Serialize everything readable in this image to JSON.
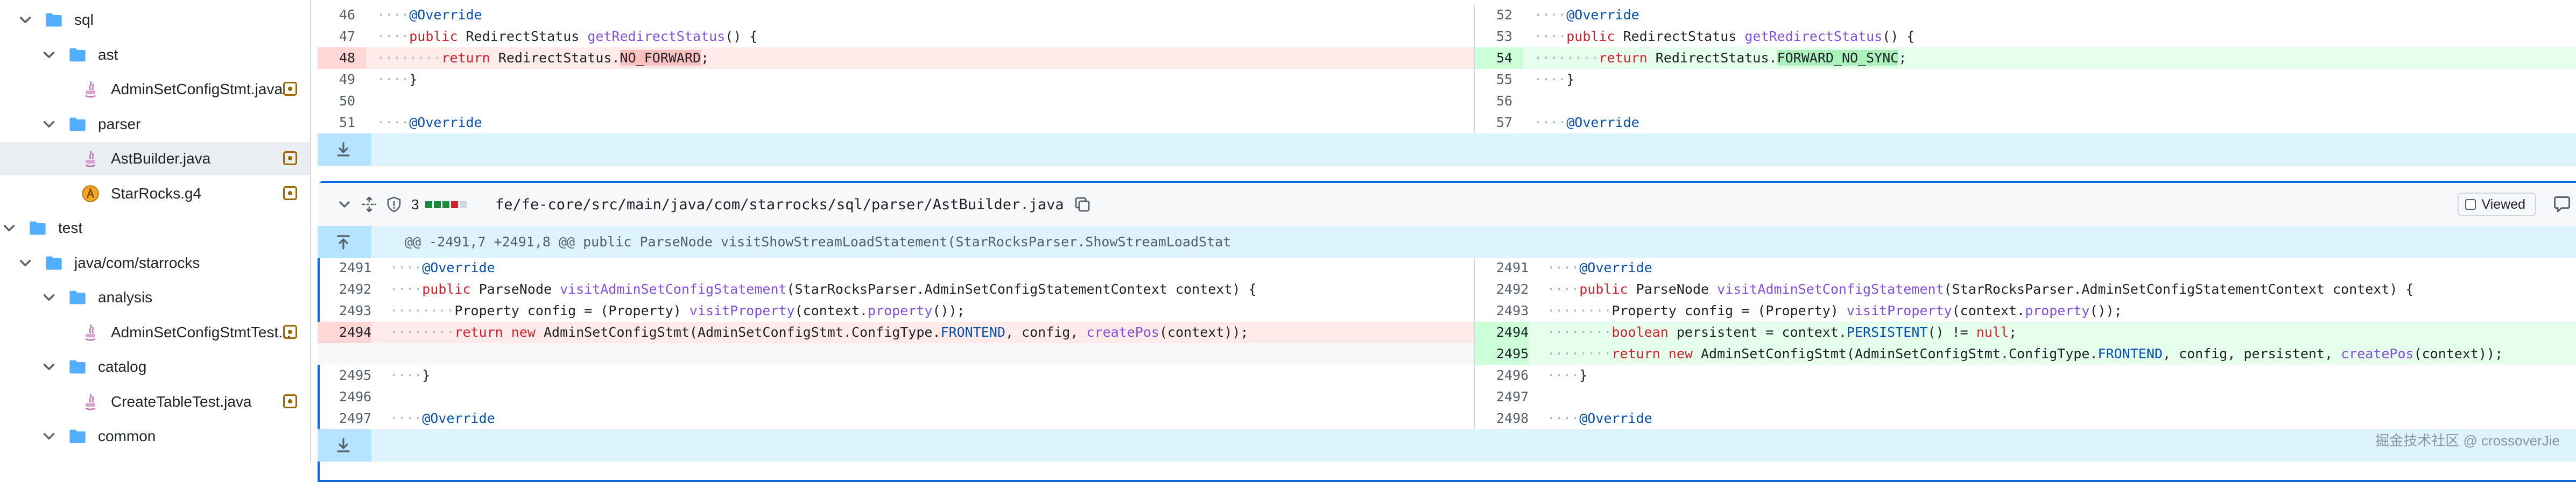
{
  "file_tree": [
    {
      "type": "folder",
      "label": "sql",
      "depth": 0,
      "expanded": true
    },
    {
      "type": "folder",
      "label": "ast",
      "depth": 1,
      "expanded": true
    },
    {
      "type": "file",
      "icon": "java",
      "label": "AdminSetConfigStmt.java",
      "depth": 2,
      "modified": true
    },
    {
      "type": "folder",
      "label": "parser",
      "depth": 1,
      "expanded": true
    },
    {
      "type": "file",
      "icon": "java",
      "label": "AstBuilder.java",
      "depth": 2,
      "modified": true,
      "selected": true
    },
    {
      "type": "file",
      "icon": "antlr",
      "label": "StarRocks.g4",
      "depth": 2,
      "modified": true
    },
    {
      "type": "folder",
      "label": "test",
      "depth": -1,
      "expanded": true
    },
    {
      "type": "folder",
      "label": "java/com/starrocks",
      "depth": 0,
      "expanded": true
    },
    {
      "type": "folder",
      "label": "analysis",
      "depth": 1,
      "expanded": true
    },
    {
      "type": "file",
      "icon": "java",
      "label": "AdminSetConfigStmtTest...",
      "depth": 2,
      "modified": true
    },
    {
      "type": "folder",
      "label": "catalog",
      "depth": 1,
      "expanded": true
    },
    {
      "type": "file",
      "icon": "java",
      "label": "CreateTableTest.java",
      "depth": 2,
      "modified": true
    },
    {
      "type": "folder",
      "label": "common",
      "depth": 1,
      "expanded": true
    }
  ],
  "top_diff": {
    "left": [
      {
        "n": "46",
        "code": "····@Override",
        "kind": "ctx"
      },
      {
        "n": "47",
        "code": "····public RedirectStatus getRedirectStatus() {",
        "kind": "ctx"
      },
      {
        "n": "48",
        "code": "········return RedirectStatus.NO_FORWARD;",
        "kind": "del"
      },
      {
        "n": "49",
        "code": "····}",
        "kind": "ctx"
      },
      {
        "n": "50",
        "code": "",
        "kind": "ctx"
      },
      {
        "n": "51",
        "code": "····@Override",
        "kind": "ctx"
      }
    ],
    "right": [
      {
        "n": "52",
        "code": "····@Override",
        "kind": "ctx"
      },
      {
        "n": "53",
        "code": "····public RedirectStatus getRedirectStatus() {",
        "kind": "ctx"
      },
      {
        "n": "54",
        "code": "········return RedirectStatus.FORWARD_NO_SYNC;",
        "kind": "add"
      },
      {
        "n": "55",
        "code": "····}",
        "kind": "ctx"
      },
      {
        "n": "56",
        "code": "",
        "kind": "ctx"
      },
      {
        "n": "57",
        "code": "····@Override",
        "kind": "ctx"
      }
    ]
  },
  "file_header": {
    "count": "3",
    "path": "fe/fe-core/src/main/java/com/starrocks/sql/parser/AstBuilder.java",
    "viewed_label": "Viewed",
    "stat_colors": [
      "#1f883d",
      "#1f883d",
      "#1f883d",
      "#cf222e",
      "#d0d7de"
    ]
  },
  "hunk_header": "@@ -2491,7 +2491,8 @@ public ParseNode visitShowStreamLoadStatement(StarRocksParser.ShowStreamLoadStat",
  "bottom_diff": {
    "left": [
      {
        "n": "2491",
        "code": "····@Override",
        "kind": "ctx"
      },
      {
        "n": "2492",
        "code": "····public ParseNode visitAdminSetConfigStatement(StarRocksParser.AdminSetConfigStatementContext context) {",
        "kind": "ctx"
      },
      {
        "n": "2493",
        "code": "········Property config = (Property) visitProperty(context.property());",
        "kind": "ctx"
      },
      {
        "n": "2494",
        "code": "········return new AdminSetConfigStmt(AdminSetConfigStmt.ConfigType.FRONTEND, config, createPos(context));",
        "kind": "del"
      },
      {
        "n": "",
        "code": "",
        "kind": "empty"
      },
      {
        "n": "2495",
        "code": "····}",
        "kind": "ctx"
      },
      {
        "n": "2496",
        "code": "",
        "kind": "ctx"
      },
      {
        "n": "2497",
        "code": "····@Override",
        "kind": "ctx"
      }
    ],
    "right": [
      {
        "n": "2491",
        "code": "····@Override",
        "kind": "ctx"
      },
      {
        "n": "2492",
        "code": "····public ParseNode visitAdminSetConfigStatement(StarRocksParser.AdminSetConfigStatementContext context) {",
        "kind": "ctx"
      },
      {
        "n": "2493",
        "code": "········Property config = (Property) visitProperty(context.property());",
        "kind": "ctx"
      },
      {
        "n": "2494",
        "code": "········boolean persistent = context.PERSISTENT() != null;",
        "kind": "add"
      },
      {
        "n": "2495",
        "code": "········return new AdminSetConfigStmt(AdminSetConfigStmt.ConfigType.FRONTEND, config, persistent, createPos(context));",
        "kind": "add"
      },
      {
        "n": "2496",
        "code": "····}",
        "kind": "ctx"
      },
      {
        "n": "2497",
        "code": "",
        "kind": "ctx"
      },
      {
        "n": "2498",
        "code": "····@Override",
        "kind": "ctx"
      }
    ]
  },
  "watermark": "掘金技术社区 @ crossoverJie",
  "colors": {
    "accent": "#0969da",
    "del_bg": "#ffebe9",
    "add_bg": "#e6ffec",
    "modified": "#9a6700",
    "folder": "#54aeff"
  }
}
